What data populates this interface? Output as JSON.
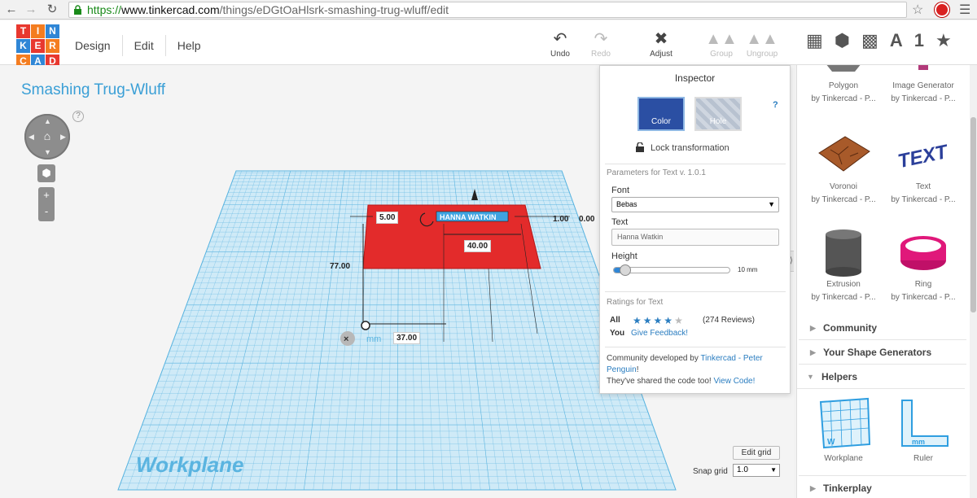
{
  "browser": {
    "url_https": "https://",
    "url_host": "www.tinkercad.com",
    "url_path": "/things/eDGtOaHlsrk-smashing-trug-wluff/edit"
  },
  "app": {
    "logo_letters": [
      "T",
      "I",
      "N",
      "K",
      "E",
      "R",
      "C",
      "A",
      "D"
    ],
    "logo_colors": [
      "#e8382f",
      "#f47d20",
      "#2f86d6",
      "#2f86d6",
      "#e8382f",
      "#f47d20",
      "#f47d20",
      "#2f86d6",
      "#e8382f"
    ],
    "menu": [
      "Design",
      "Edit",
      "Help"
    ],
    "tools": {
      "undo": "Undo",
      "redo": "Redo",
      "adjust": "Adjust",
      "group": "Group",
      "ungroup": "Ungroup"
    },
    "view_icons": [
      "grid-icon",
      "cube-icon",
      "cube-hole-icon",
      "text-icon",
      "number-icon",
      "star-icon"
    ],
    "view_glyphs": {
      "text": "A",
      "number": "1",
      "star": "★"
    }
  },
  "viewport": {
    "design_title": "Smashing Trug-Wluff",
    "help": "?",
    "workplane_label": "Workplane",
    "unit": "mm",
    "dims": {
      "height": "5.00",
      "depth": "1.00",
      "offset": "0.00",
      "length": "40.00",
      "y": "77.00",
      "x": "37.00"
    },
    "edit_grid": "Edit grid",
    "snap_grid_label": "Snap grid",
    "snap_grid_value": "1.0",
    "shape_text": "HANNA WATKIN"
  },
  "inspector": {
    "title": "Inspector",
    "color_label": "Color",
    "hole_label": "Hole",
    "help": "?",
    "lock_label": "Lock transformation",
    "params_title": "Parameters for Text v. 1.0.1",
    "font_label": "Font",
    "font_value": "Bebas",
    "text_label": "Text",
    "text_value": "Hanna Watkin",
    "height_label": "Height",
    "height_value": "10 mm",
    "height_fraction": 0.1,
    "ratings_title": "Ratings for Text",
    "all_label": "All",
    "all_rating": 4,
    "reviews": "(274 Reviews)",
    "you_label": "You",
    "feedback": "Give Feedback!",
    "credits_prefix": "Community developed by ",
    "credits_link": "Tinkercad - Peter Penguin",
    "credits_mid": "!",
    "credits_line2": "They've shared the code too! ",
    "view_code": "View Code!"
  },
  "sidebar": {
    "shapes": [
      {
        "name": "Polygon",
        "by": "by Tinkercad - P..."
      },
      {
        "name": "Image Generator",
        "by": "by Tinkercad - P..."
      },
      {
        "name": "Voronoi",
        "by": "by Tinkercad - P..."
      },
      {
        "name": "Text",
        "by": "by Tinkercad - P..."
      },
      {
        "name": "Extrusion",
        "by": "by Tinkercad - P..."
      },
      {
        "name": "Ring",
        "by": "by Tinkercad - P..."
      }
    ],
    "sections": [
      "Community",
      "Your Shape Generators",
      "Helpers",
      "Tinkerplay"
    ],
    "helpers": [
      {
        "name": "Workplane"
      },
      {
        "name": "Ruler"
      }
    ],
    "colors": {
      "voronoi": "#a85a2a",
      "text_shape": "#2b3f9a",
      "extrusion": "#555555",
      "ring": "#e0187a",
      "helper": "#2f9ee0"
    }
  }
}
